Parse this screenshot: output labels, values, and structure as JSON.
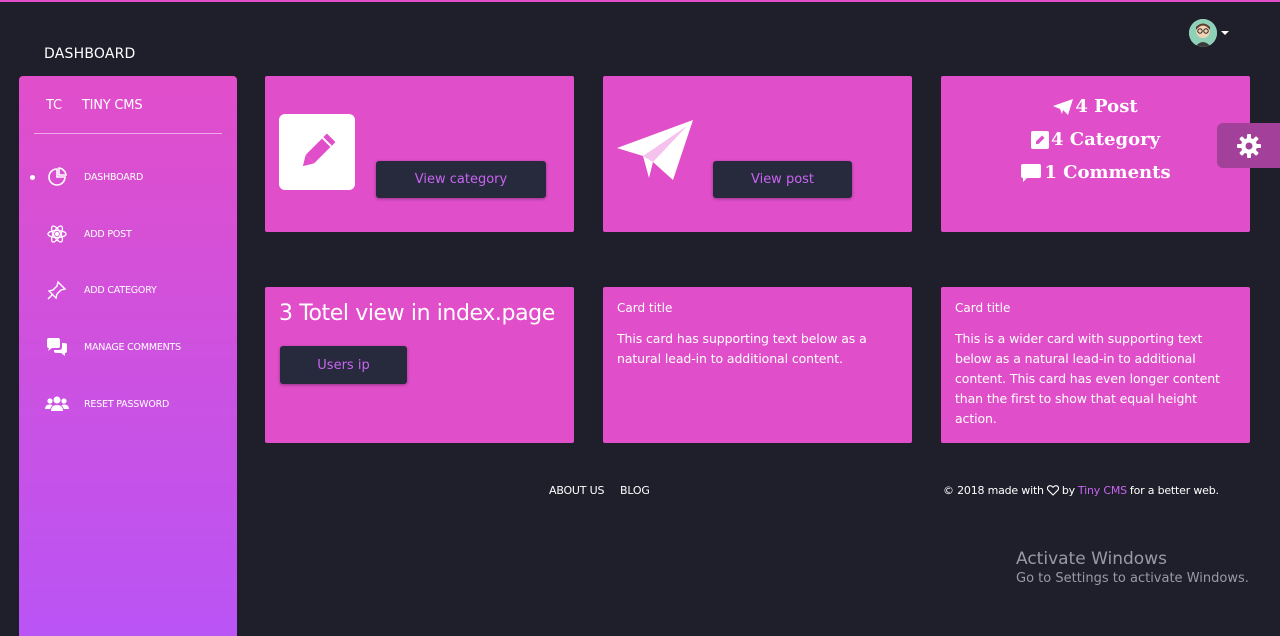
{
  "header": {
    "brand": "DASHBOARD"
  },
  "sidebar": {
    "logo_mini": "TC",
    "logo_text": "TINY CMS",
    "items": [
      {
        "label": "DASHBOARD",
        "icon": "chart-pie-icon",
        "active": true
      },
      {
        "label": "ADD POST",
        "icon": "atom-icon"
      },
      {
        "label": "ADD CATEGORY",
        "icon": "pin-icon"
      },
      {
        "label": "MANAGE COMMENTS",
        "icon": "chat-bubbles-icon"
      },
      {
        "label": "RESET PASSWORD",
        "icon": "users-icon"
      }
    ]
  },
  "cards": {
    "category": {
      "button": "View category",
      "icon": "pencil-icon"
    },
    "post": {
      "button": "View post",
      "icon": "paper-plane-icon"
    },
    "stats": {
      "posts": "4 Post",
      "categories": "4 Category",
      "comments": "1 Comments"
    },
    "views": {
      "title": "3 Totel view in index.page",
      "button": "Users ip"
    },
    "card1": {
      "title": "Card title",
      "text": "This card has supporting text below as a natural lead-in to additional content."
    },
    "card2": {
      "title": "Card title",
      "text": "This is a wider card with supporting text below as a natural lead-in to additional content. This card has even longer content than the first to show that equal height action."
    }
  },
  "footer": {
    "links": [
      "ABOUT US",
      "BLOG"
    ],
    "copy_prefix": "© 2018 made with",
    "copy_by": "by",
    "copy_brand": "Tiny CMS",
    "copy_suffix": "for a better web."
  },
  "watermark": {
    "line1": "Activate Windows",
    "line2": "Go to Settings to activate Windows."
  },
  "colors": {
    "accent": "#e14eca",
    "accent2": "#ba54f5",
    "background": "#1f1e2b",
    "button": "#27293d",
    "button_text": "#c865f0"
  }
}
